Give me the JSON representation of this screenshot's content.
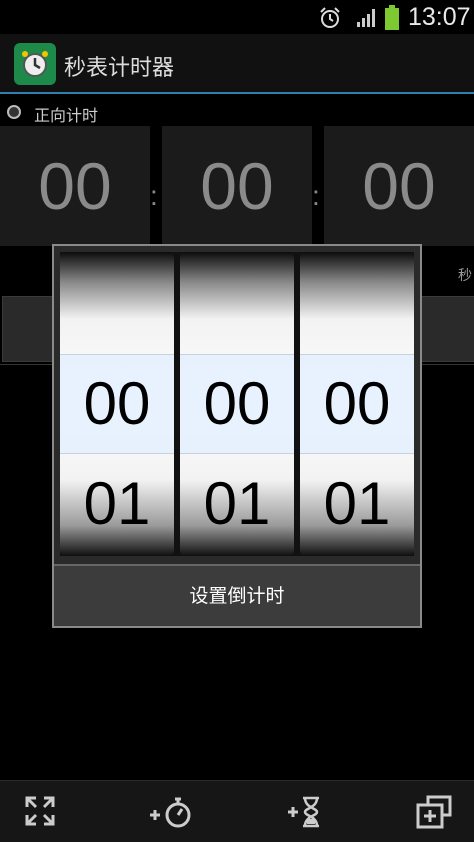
{
  "status_bar": {
    "time": "13:07"
  },
  "app": {
    "title": "秒表计时器"
  },
  "mode": {
    "label": "正向计时"
  },
  "timer": {
    "hours": "00",
    "minutes": "00",
    "seconds": "00",
    "sep1": ":",
    "sep2": ":",
    "seconds_unit": "秒"
  },
  "dialog": {
    "wheels": [
      {
        "selected": "00",
        "next": "01"
      },
      {
        "selected": "00",
        "next": "01"
      },
      {
        "selected": "00",
        "next": "01"
      }
    ],
    "button_label": "设置倒计时"
  },
  "bottom_bar": {
    "icons": [
      "fullscreen-icon",
      "add-stopwatch-icon",
      "add-hourglass-icon",
      "add-window-icon"
    ]
  },
  "colors": {
    "app_icon_bg": "#1d8a4a",
    "action_bar_accent": "#2f7fb0",
    "battery": "#7ec832"
  }
}
